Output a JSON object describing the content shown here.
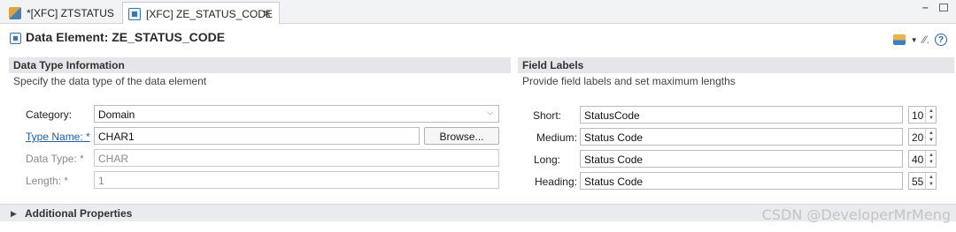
{
  "tabs": [
    {
      "label": "*[XFC] ZTSTATUS",
      "active": false
    },
    {
      "label": "[XFC] ZE_STATUS_CODE",
      "active": true
    }
  ],
  "editor": {
    "title": "Data Element: ZE_STATUS_CODE"
  },
  "data_type": {
    "header": "Data Type Information",
    "description": "Specify the data type of the data element",
    "category_label": "Category:",
    "category_value": "Domain",
    "type_name_label": "Type Name: *",
    "type_name_value": "CHAR1",
    "browse_label": "Browse...",
    "data_type_label": "Data Type: *",
    "data_type_value": "CHAR",
    "length_label": "Length: *",
    "length_value": "1"
  },
  "field_labels": {
    "header": "Field Labels",
    "description": "Provide field labels and set maximum lengths",
    "rows": [
      {
        "label": "Short:",
        "value": "StatusCode",
        "length": "10"
      },
      {
        "label": "Medium:",
        "value": "Status Code",
        "length": "20"
      },
      {
        "label": "Long:",
        "value": "Status Code",
        "length": "40"
      },
      {
        "label": "Heading:",
        "value": "Status Code",
        "length": "55"
      }
    ]
  },
  "additional": {
    "label": "Additional Properties"
  },
  "watermark": "CSDN @DeveloperMrMeng"
}
